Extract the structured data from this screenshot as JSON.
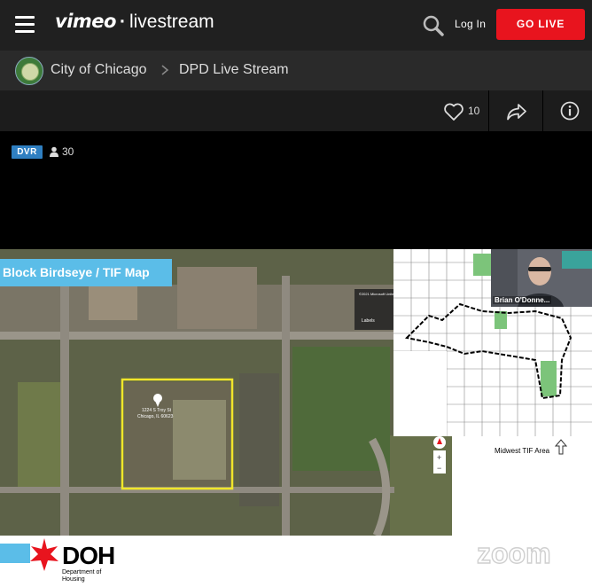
{
  "header": {
    "logo_primary": "vimeo",
    "logo_separator": "·",
    "logo_secondary": "livestream",
    "login_label": "Log In",
    "go_live_label": "GO LIVE",
    "accent_color": "#e8141e"
  },
  "breadcrumb": {
    "items": [
      {
        "label": "City of Chicago"
      },
      {
        "label": "DPD Live Stream"
      }
    ]
  },
  "actions": {
    "like_count": "10",
    "icons": [
      "heart-icon",
      "share-icon",
      "info-icon"
    ]
  },
  "stream": {
    "dvr_badge": "DVR",
    "viewer_count": "30",
    "dvr_color": "#2f7fc1"
  },
  "slide": {
    "title": "Block Birdseye / TIF Map",
    "map_attribution": "©2021 Microsoft United States, North Lawndale",
    "labels_button": "Labels",
    "pin_address_line1": "1224 S Troy St",
    "pin_address_line2": "Chicago, IL 60623",
    "tif_area_label": "Midwest TIF Area",
    "doh_logo": "DOH",
    "doh_subtitle_line1": "Department of",
    "doh_subtitle_line2": "Housing",
    "zoom_watermark": "zoom"
  },
  "webcam": {
    "participant_name": "Brian O'Donne..."
  }
}
